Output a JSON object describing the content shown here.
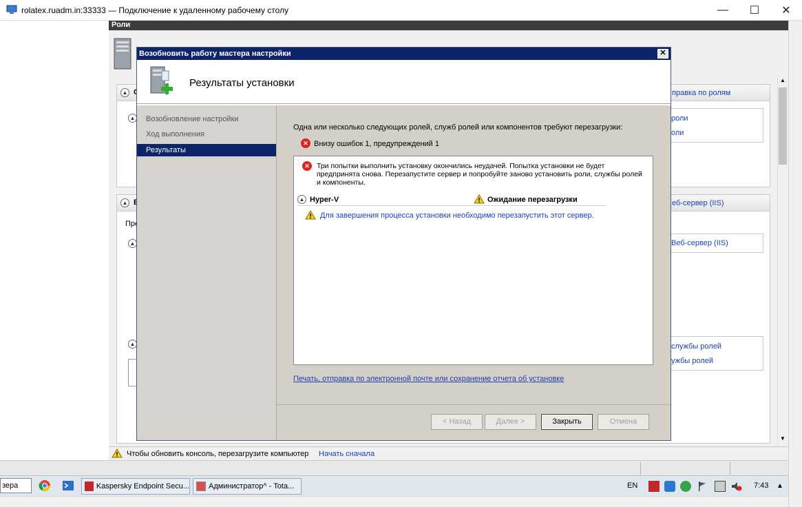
{
  "window": {
    "title": "rolatex.ruadm.in:33333 — Подключение к удаленному рабочему столу",
    "minimize": "—",
    "maximize": "☐",
    "close": "✕"
  },
  "server_manager": {
    "header": "Роли",
    "right_links": {
      "help_roles": "правка по ролям",
      "roles_1": "роли",
      "roles_2": "оли",
      "web_server_head": "еб-сервер (IIS)",
      "web_server_link": "Веб-сервер (IIS)",
      "role_services_1": "службы ролей",
      "role_services_2": "ужбы ролей"
    },
    "left_fragments": {
      "panel1": "О",
      "panel2": "В",
      "pre": "Пре"
    },
    "status": {
      "message": "Чтобы обновить консоль, перезагрузите компьютер",
      "restart_link": "Начать сначала"
    }
  },
  "dialog": {
    "title": "Возобновить работу мастера настройки",
    "heading": "Результаты установки",
    "nav": {
      "items": [
        "Возобновление настройки",
        "Ход выполнения",
        "Результаты"
      ],
      "selected_index": 2
    },
    "content": {
      "intro": "Одна или несколько следующих ролей, служб ролей или компонентов требуют перезагрузки:",
      "summary": "Внизу ошибок 1, предупреждений 1",
      "error_message": "Три попытки выполнить установку окончились неудачей. Попытка установки не будет предпринята снова. Перезапустите сервер и попробуйте заново установить роли, службы ролей и компоненты.",
      "role_name": "Hyper-V",
      "role_status": "Ожидание перезагрузки",
      "warning_message": "Для завершения процесса установки необходимо перезапустить этот сервер.",
      "report_link": "Печать, отправка по электронной почте или сохранение отчета об установке"
    },
    "buttons": {
      "back": "< Назад",
      "next": "Далее >",
      "close": "Закрыть",
      "cancel": "Отмена"
    }
  },
  "taskbar": {
    "search_fragment": "зера",
    "items": [
      "Kaspersky Endpoint Secu...",
      "Администратор^ - Tota..."
    ],
    "language": "EN",
    "time": "7:43"
  }
}
